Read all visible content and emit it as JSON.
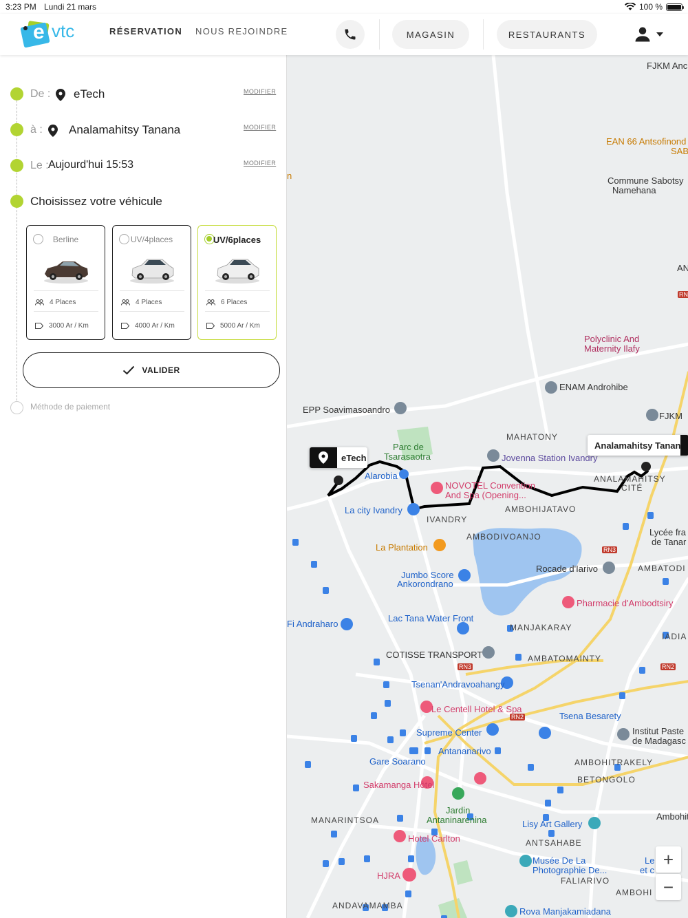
{
  "status_bar": {
    "time": "3:23 PM",
    "date": "Lundi 21 mars",
    "battery": "100 %"
  },
  "header": {
    "logo_e": "e",
    "logo_vtc": "vtc",
    "nav_reservation": "RÉSERVATION",
    "nav_join": "NOUS REJOINDRE",
    "magasin": "MAGASIN",
    "restaurants": "RESTAURANTS"
  },
  "booking": {
    "from_label": "De :",
    "from_value": "eTech",
    "to_label": "à :",
    "to_value": "Analamahitsy Tanana",
    "date_label": "Le :",
    "date_value": "Aujourd'hui 15:53",
    "modify": "MODIFIER",
    "choose_vehicle": "Choisissez votre véhicule",
    "vehicles": [
      {
        "name": "Berline",
        "places": "4 Places",
        "price": "3000 Ar / Km",
        "selected": false
      },
      {
        "name": "UV/4places",
        "places": "4 Places",
        "price": "4000 Ar / Km",
        "selected": false
      },
      {
        "name": "UV/6places",
        "places": "6 Places",
        "price": "5000 Ar / Km",
        "selected": true
      }
    ],
    "validate": "VALIDER",
    "payment": "Méthode de paiement"
  },
  "map": {
    "origin_label": "eTech",
    "destination_label": "Analamahitsy Tanan",
    "zoom_in": "+",
    "zoom_out": "−",
    "places": [
      "FJKM Anc",
      "EAN 66 Antsofinond",
      "SAB/Na",
      "Commune Sabotsy",
      "Namehana",
      "AN",
      "RN",
      "Polyclinic And",
      "Maternity Ilafy",
      "ENAM Androhibe",
      "FJKM",
      "EPP Soavimasoandro",
      "Parc de",
      "Tsarasaotra",
      "MAHATONY",
      "Jovenna Station Ivandry",
      "Alarobia",
      "NOVOTEL Convention",
      "And Spa (Opening...",
      "ANALAMAHITSY",
      "CITÉ",
      "La city Ivandry",
      "AMBOHIJATAVO",
      "IVANDRY",
      "Lycée fra",
      "de Tanar",
      "AMBODIVOANJO",
      "La Plantation",
      "RN3",
      "Rocade d'Iarivo",
      "AMBATODI",
      "Jumbo Score",
      "Ankorondrano",
      "Pharmacie d'Ambodtsiry",
      "Fi Andraharo",
      "Lac Tana Water Front",
      "MANJAKARAY",
      "IADIA",
      "COTISSE TRANSPORT",
      "AMBATOMAINTY",
      "RN3",
      "RN2",
      "Tsenan'Andravoahangy",
      "Le Centell Hotel & Spa",
      "RN2",
      "Tsena Besarety",
      "Supreme Center",
      "Institut Paste",
      "de Madagasc",
      "Antananarivo",
      "Gare Soarano",
      "AMBOHITRAKELY",
      "Sakamanga Hôtel",
      "BETONGOLO",
      "Jardin",
      "Antaninarenina",
      "MANARINTSOA",
      "Lisy Art Gallery",
      "Ambohitsair",
      "Hotel Carlton",
      "ANTSAHABE",
      "Musée De La",
      "Photographie De...",
      "Le",
      "et c",
      "HJRA",
      "FALIARIVO",
      "ANDAVAMAMBA",
      "Rova Manjakamiadana",
      "AMBOHI",
      "n"
    ]
  },
  "colors": {
    "accent_green": "#b2d432",
    "brand_blue": "#37b8e8",
    "route": "#000000"
  }
}
